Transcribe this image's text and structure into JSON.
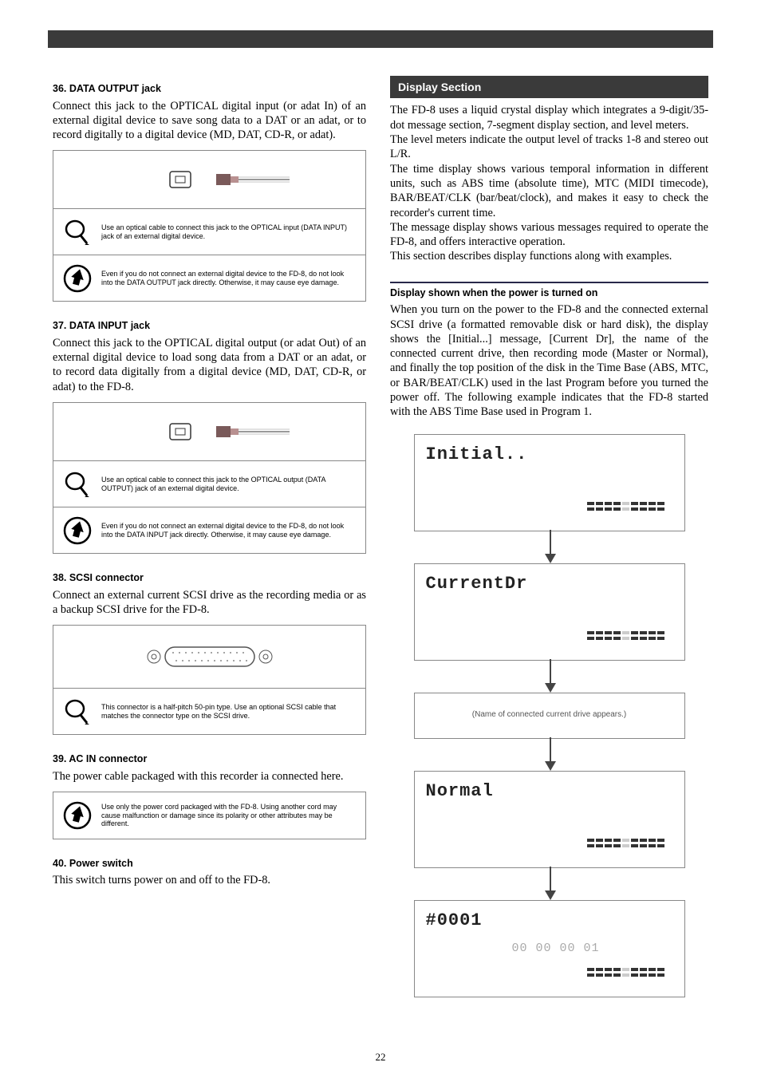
{
  "page_number": "22",
  "left": {
    "s1": {
      "heading": "36. DATA OUTPUT jack",
      "body": "Connect this jack to the OPTICAL digital input (or adat In) of an external digital device to save song data to a DAT or an adat, or to record digitally to a digital device (MD, DAT, CD-R, or adat).",
      "hint": "Use an optical cable to connect this jack to the OPTICAL input (DATA INPUT) jack of an external digital device.",
      "caution": "Even if you do not connect an external digital device to the FD-8, do not look into the DATA OUTPUT jack directly. Otherwise, it may cause eye damage."
    },
    "s2": {
      "heading": "37. DATA INPUT jack",
      "body": "Connect this jack to the OPTICAL digital output (or adat Out) of an external digital device to load song data from a DAT or an adat, or to record data digitally from a digital device (MD, DAT, CD-R, or adat) to the FD-8.",
      "hint": "Use an optical cable to connect this jack to the OPTICAL output (DATA OUTPUT) jack of an external digital device.",
      "caution": "Even if you do not connect an external digital device to the FD-8, do not look into the DATA INPUT jack directly. Otherwise, it may cause eye damage."
    },
    "s3": {
      "heading": "38. SCSI connector",
      "body": "Connect an external current SCSI drive as the recording media or as a backup SCSI drive for the FD-8.",
      "hint": "This connector is a half-pitch 50-pin type. Use an optional SCSI cable that matches the connector type on the SCSI drive."
    },
    "s4": {
      "heading": "39. AC IN connector",
      "body": "The power cable packaged with this recorder ia connected here.",
      "caution": "Use only the power cord packaged with the FD-8. Using another cord may cause malfunction or damage since its polarity or other attributes may be different."
    },
    "s5": {
      "heading": "40. Power switch",
      "body": "This switch turns power on and off to the FD-8."
    }
  },
  "right": {
    "heading_bar": "Display Section",
    "intro": [
      "The FD-8 uses a liquid crystal display which integrates a 9-digit/35-dot message section, 7-segment display section, and level meters.",
      "The level meters indicate the output level of tracks 1-8 and stereo out L/R.",
      "The time display shows various temporal information in different units, such as ABS time (absolute time), MTC (MIDI timecode), BAR/BEAT/CLK (bar/beat/clock), and makes it easy to check the recorder's current time.",
      "The message display shows various messages required to operate the FD-8, and offers interactive operation.",
      "This section describes display functions along with examples."
    ],
    "sub_heading": "Display shown when the power is turned on",
    "sub_body": "When you turn on the power to the FD-8 and the connected external SCSI drive (a formatted removable disk or hard disk), the display shows the [Initial...] message, [Current Dr], the name of the connected current drive, then recording mode (Master or Normal), and finally the top position of the disk in the Time Base (ABS, MTC, or BAR/BEAT/CLK) used in the last Program before you turned the power off. The following example indicates that the FD-8 started with the ABS Time Base used in Program 1.",
    "panels": {
      "p1": "Initial..",
      "p2": "CurrentDr",
      "p3_caption": "(Name of connected current drive appears.)",
      "p4": "Normal",
      "p5_top": "#0001",
      "p5_time": "00  00  00  01"
    }
  }
}
